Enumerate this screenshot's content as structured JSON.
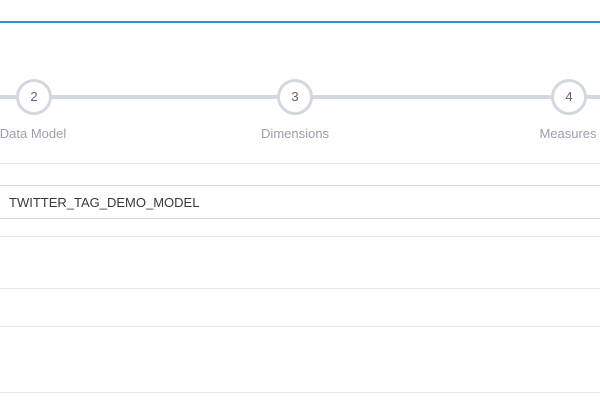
{
  "wizard": {
    "steps": [
      {
        "number": "2",
        "label": "Data Model"
      },
      {
        "number": "3",
        "label": "Dimensions"
      },
      {
        "number": "4",
        "label": "Measures"
      }
    ]
  },
  "form": {
    "model_name_value": "TWITTER_TAG_DEMO_MODEL"
  },
  "colors": {
    "accent": "#3a8fcb",
    "step_line": "#d3d8de",
    "divider": "#e5e7ea"
  }
}
